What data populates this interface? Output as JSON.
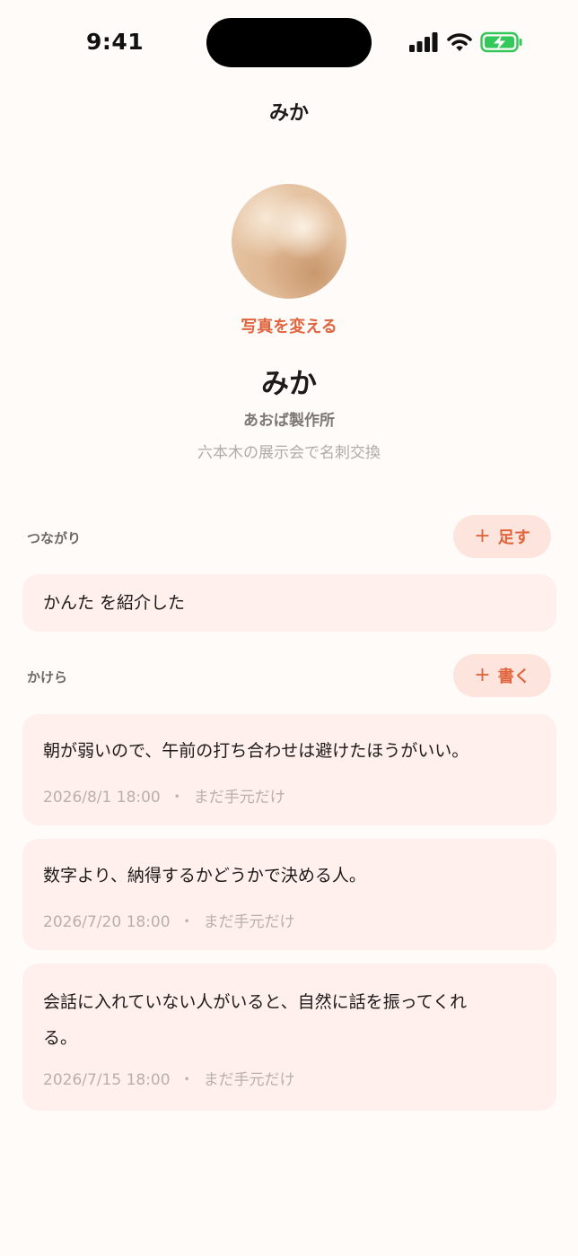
{
  "status_bar": {
    "time": "9:41",
    "signal_icon": "cellular-signal-icon",
    "wifi_icon": "wifi-icon",
    "battery_icon": "battery-charging-icon",
    "battery_color": "#34c759"
  },
  "nav": {
    "title": "みか"
  },
  "profile": {
    "change_photo_label": "写真を変える",
    "name": "みか",
    "company": "あおば製作所",
    "note": "六本木の展示会で名刺交換"
  },
  "connections": {
    "label": "つながり",
    "add_button": {
      "icon": "plus-icon",
      "plus": "+",
      "label": "足す"
    },
    "items": [
      {
        "text": "かんた を紹介した"
      }
    ]
  },
  "notes": {
    "label": "かけら",
    "write_button": {
      "icon": "plus-icon",
      "plus": "+",
      "label": "書く"
    },
    "separator": "・",
    "items": [
      {
        "text": "朝が弱いので、午前の打ち合わせは避けたほうがいい。",
        "date": "2026/8/1 18:00",
        "status": "まだ手元だけ"
      },
      {
        "text": "数字より、納得するかどうかで決める人。",
        "date": "2026/7/20 18:00",
        "status": "まだ手元だけ"
      },
      {
        "text_line1": "会話に入れていない人がいると、自然に話を振ってくれ",
        "text_line2": "る。",
        "date": "2026/7/15 18:00",
        "status": "まだ手元だけ"
      }
    ]
  },
  "colors": {
    "accent": "#e0653e",
    "pill_bg": "#fde4dc",
    "card_bg": "#fff0ed",
    "page_bg": "#fffbf9"
  }
}
